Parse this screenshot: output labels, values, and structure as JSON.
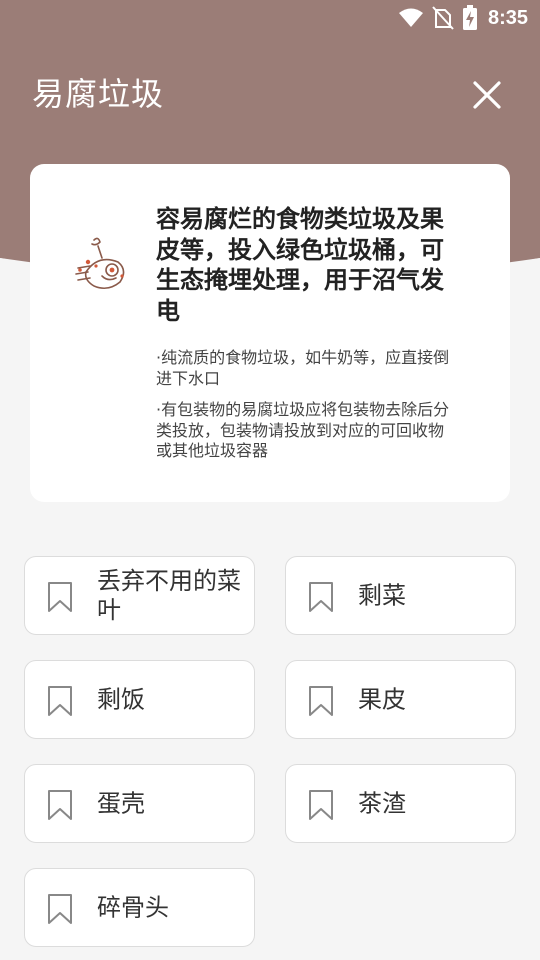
{
  "status_bar": {
    "time": "8:35",
    "icons": [
      "wifi-icon",
      "no-sim-icon",
      "battery-charging-icon"
    ]
  },
  "header": {
    "title": "易腐垃圾",
    "close_icon": "close-icon",
    "background_color": "#9b7d77"
  },
  "info": {
    "icon": "food-waste-icon",
    "headline": "容易腐烂的食物类垃圾及果皮等，投入绿色垃圾桶，可生态掩埋处理，用于沼气发电",
    "notes": [
      "·纯流质的食物垃圾，如牛奶等，应直接倒进下水口",
      "·有包装物的易腐垃圾应将包装物去除后分类投放，包装物请投放到对应的可回收物或其他垃圾容器"
    ]
  },
  "items": [
    {
      "label": "丢弃不用的菜叶",
      "icon": "bookmark-icon"
    },
    {
      "label": "剩菜",
      "icon": "bookmark-icon"
    },
    {
      "label": "剩饭",
      "icon": "bookmark-icon"
    },
    {
      "label": "果皮",
      "icon": "bookmark-icon"
    },
    {
      "label": "蛋壳",
      "icon": "bookmark-icon"
    },
    {
      "label": "茶渣",
      "icon": "bookmark-icon"
    },
    {
      "label": "碎骨头",
      "icon": "bookmark-icon"
    }
  ]
}
